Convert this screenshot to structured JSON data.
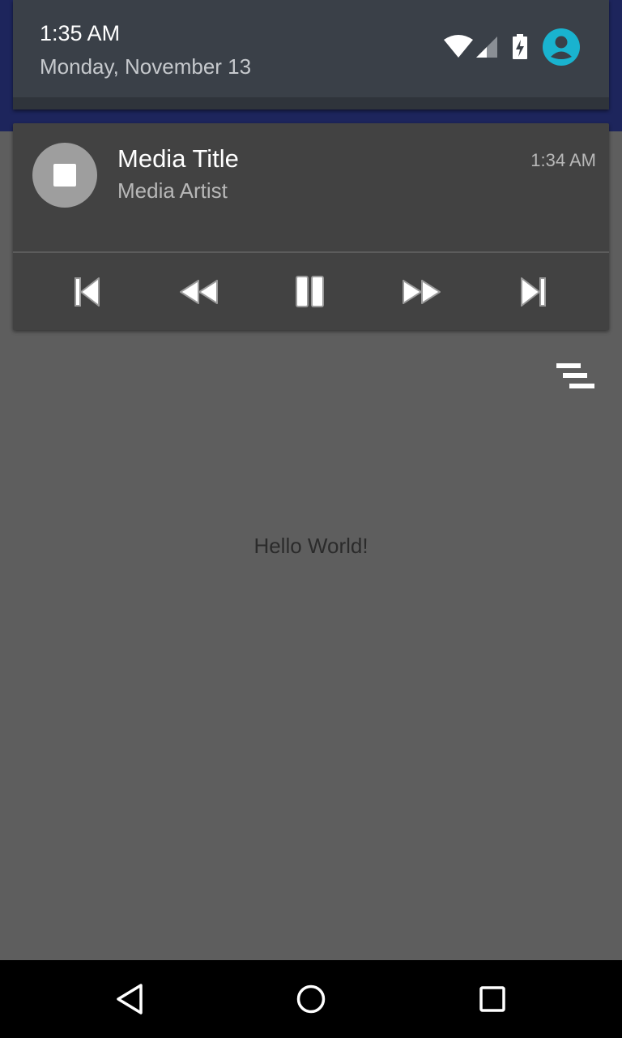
{
  "quick_settings": {
    "time": "1:35 AM",
    "date": "Monday, November 13",
    "icons": [
      "wifi-icon",
      "cell-signal-icon",
      "battery-charging-icon",
      "user-avatar-icon"
    ],
    "avatar_color": "#19b3cf"
  },
  "media_notification": {
    "title": "Media Title",
    "artist": "Media Artist",
    "time": "1:34 AM",
    "controls": [
      "skip-previous-icon",
      "rewind-icon",
      "pause-icon",
      "fast-forward-icon",
      "skip-next-icon"
    ]
  },
  "app": {
    "greeting": "Hello World!",
    "header_color": "#1d255c"
  },
  "navigation_bar": {
    "buttons": [
      "back-icon",
      "home-icon",
      "recents-icon"
    ]
  }
}
